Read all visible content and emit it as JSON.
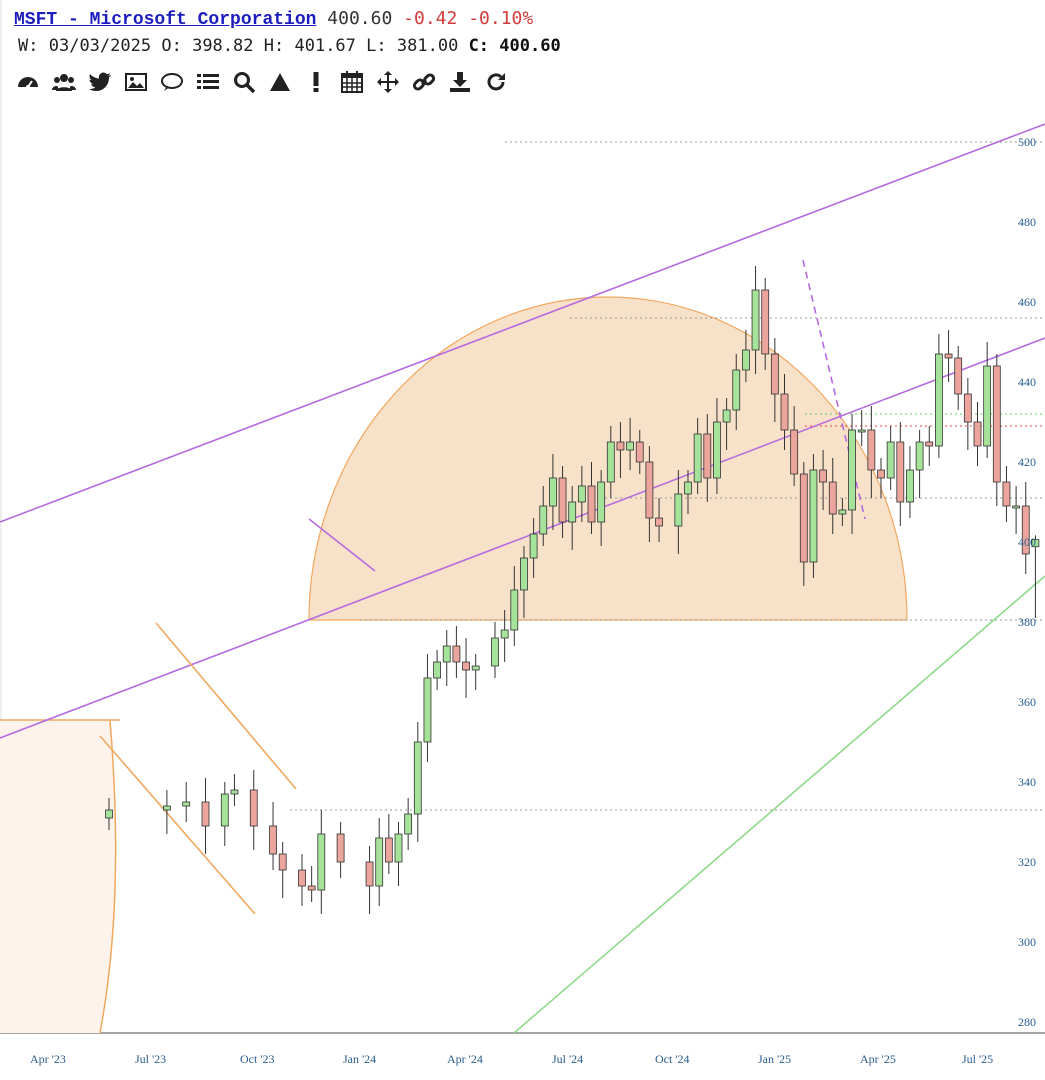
{
  "header": {
    "symbol_title": "MSFT - Microsoft Corporation",
    "last_price": "400.60",
    "change": "-0.42",
    "change_pct": "-0.10%",
    "period_label": "W:",
    "date": "03/03/2025",
    "open_label": "O:",
    "open": "398.82",
    "high_label": "H:",
    "high": "401.67",
    "low_label": "L:",
    "low": "381.00",
    "close_label": "C:",
    "close": "400.60"
  },
  "toolbar": [
    "dashboard-icon",
    "users-icon",
    "twitter-icon",
    "image-icon",
    "comment-icon",
    "list-icon",
    "search-icon",
    "triangle-icon",
    "exclamation-icon",
    "calendar-icon",
    "move-icon",
    "link-icon",
    "download-icon",
    "refresh-icon"
  ],
  "colors": {
    "up": "#a6e39a",
    "down": "#eba59c",
    "channel": "#b56be0",
    "orange": "#f0a860",
    "arc_fill": "#f7dcc0",
    "green_line": "#8fd98a",
    "axis_text": "#2a5d8f"
  },
  "chart_data": {
    "type": "candlestick",
    "interval": "weekly",
    "ylim": [
      276,
      504
    ],
    "y_ticks": [
      280,
      300,
      320,
      340,
      360,
      380,
      400,
      420,
      440,
      460,
      480,
      500
    ],
    "x_ticks": [
      "Apr '23",
      "Jul '23",
      "Oct '23",
      "Jan '24",
      "Apr '24",
      "Jul '24",
      "Oct '24",
      "Jan '25",
      "Apr '25",
      "Jul '25"
    ],
    "last_bar": {
      "date": "03/03/2025",
      "open": 398.82,
      "high": 401.67,
      "low": 381.0,
      "close": 400.6
    },
    "closes": [
      {
        "x": 0,
        "v": 333
      },
      {
        "x": 6,
        "v": 334
      },
      {
        "x": 8,
        "v": 335
      },
      {
        "x": 10,
        "v": 329
      },
      {
        "x": 12,
        "v": 337
      },
      {
        "x": 13,
        "v": 338
      },
      {
        "x": 15,
        "v": 329
      },
      {
        "x": 17,
        "v": 322
      },
      {
        "x": 18,
        "v": 318
      },
      {
        "x": 20,
        "v": 314
      },
      {
        "x": 21,
        "v": 313
      },
      {
        "x": 22,
        "v": 327
      },
      {
        "x": 24,
        "v": 320
      },
      {
        "x": 27,
        "v": 314
      },
      {
        "x": 28,
        "v": 326
      },
      {
        "x": 29,
        "v": 320
      },
      {
        "x": 30,
        "v": 327
      },
      {
        "x": 31,
        "v": 332
      },
      {
        "x": 32,
        "v": 350
      },
      {
        "x": 33,
        "v": 366
      },
      {
        "x": 34,
        "v": 370
      },
      {
        "x": 35,
        "v": 374
      },
      {
        "x": 36,
        "v": 370
      },
      {
        "x": 37,
        "v": 368
      },
      {
        "x": 38,
        "v": 369
      },
      {
        "x": 40,
        "v": 376
      },
      {
        "x": 41,
        "v": 378
      },
      {
        "x": 42,
        "v": 388
      },
      {
        "x": 43,
        "v": 396
      },
      {
        "x": 44,
        "v": 402
      },
      {
        "x": 45,
        "v": 409
      },
      {
        "x": 46,
        "v": 416
      },
      {
        "x": 47,
        "v": 405
      },
      {
        "x": 48,
        "v": 410
      },
      {
        "x": 49,
        "v": 414
      },
      {
        "x": 50,
        "v": 405
      },
      {
        "x": 51,
        "v": 415
      },
      {
        "x": 52,
        "v": 425
      },
      {
        "x": 53,
        "v": 423
      },
      {
        "x": 54,
        "v": 425
      },
      {
        "x": 55,
        "v": 420
      },
      {
        "x": 56,
        "v": 406
      },
      {
        "x": 57,
        "v": 404
      },
      {
        "x": 59,
        "v": 412
      },
      {
        "x": 60,
        "v": 415
      },
      {
        "x": 61,
        "v": 427
      },
      {
        "x": 62,
        "v": 416
      },
      {
        "x": 63,
        "v": 430
      },
      {
        "x": 64,
        "v": 433
      },
      {
        "x": 65,
        "v": 443
      },
      {
        "x": 66,
        "v": 448
      },
      {
        "x": 67,
        "v": 463
      },
      {
        "x": 68,
        "v": 447
      },
      {
        "x": 69,
        "v": 437
      },
      {
        "x": 70,
        "v": 428
      },
      {
        "x": 71,
        "v": 417
      },
      {
        "x": 72,
        "v": 395
      },
      {
        "x": 73,
        "v": 418
      },
      {
        "x": 74,
        "v": 415
      },
      {
        "x": 75,
        "v": 407
      },
      {
        "x": 76,
        "v": 408
      },
      {
        "x": 77,
        "v": 428
      },
      {
        "x": 78,
        "v": 428
      },
      {
        "x": 79,
        "v": 418
      },
      {
        "x": 80,
        "v": 416
      },
      {
        "x": 81,
        "v": 425
      },
      {
        "x": 82,
        "v": 410
      },
      {
        "x": 83,
        "v": 418
      },
      {
        "x": 84,
        "v": 425
      },
      {
        "x": 85,
        "v": 424
      },
      {
        "x": 86,
        "v": 447
      },
      {
        "x": 87,
        "v": 446
      },
      {
        "x": 88,
        "v": 437
      },
      {
        "x": 89,
        "v": 430
      },
      {
        "x": 90,
        "v": 424
      },
      {
        "x": 91,
        "v": 444
      },
      {
        "x": 92,
        "v": 415
      },
      {
        "x": 93,
        "v": 409
      },
      {
        "x": 94,
        "v": 409
      },
      {
        "x": 95,
        "v": 397
      },
      {
        "x": 96,
        "v": 400.6
      }
    ]
  }
}
